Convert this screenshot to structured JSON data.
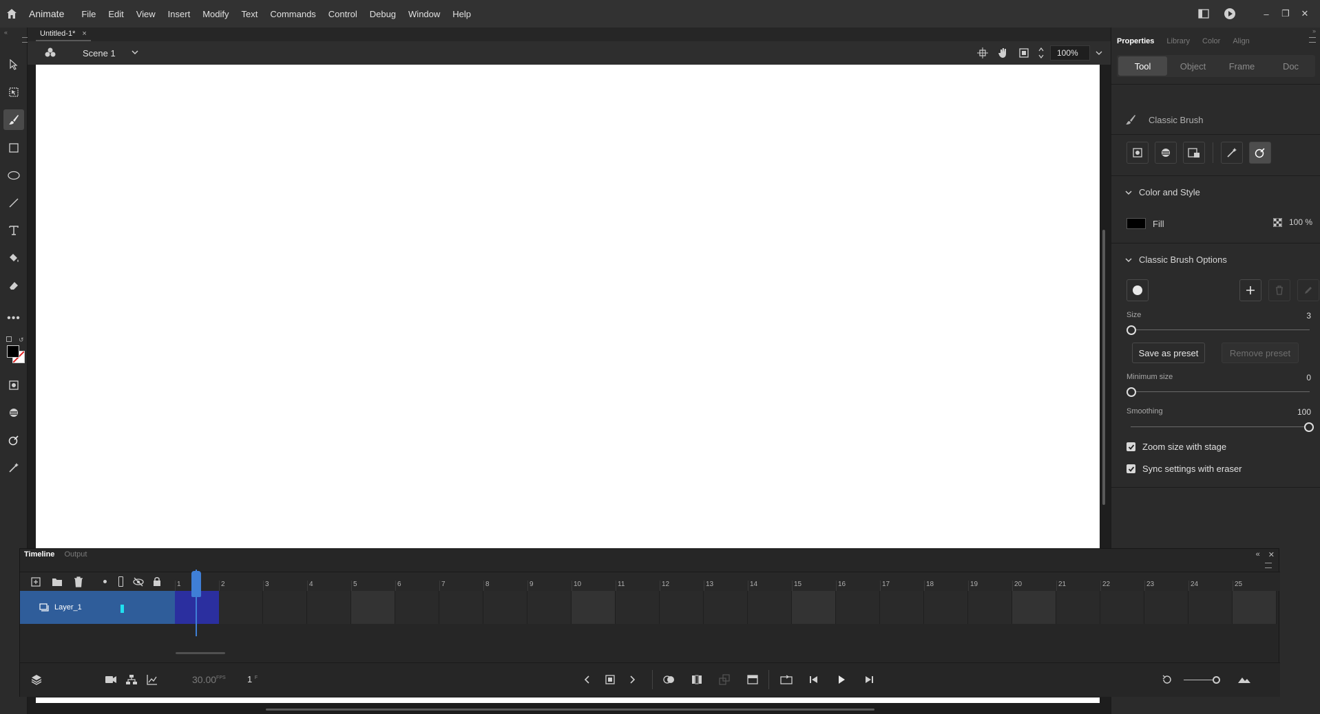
{
  "app": {
    "name": "Animate",
    "menus": [
      "File",
      "Edit",
      "View",
      "Insert",
      "Modify",
      "Text",
      "Commands",
      "Control",
      "Debug",
      "Window",
      "Help"
    ]
  },
  "document": {
    "tab_title": "Untitled-1*",
    "tab_close": "×",
    "scene_name": "Scene 1",
    "zoom": "100%"
  },
  "window_controls": {
    "minimize": "–",
    "restore": "❐",
    "close": "✕"
  },
  "properties_panel": {
    "tabs": [
      "Properties",
      "Library",
      "Color",
      "Align"
    ],
    "active_tab": "Properties",
    "subtabs": [
      "Tool",
      "Object",
      "Frame",
      "Doc"
    ],
    "active_subtab": "Tool",
    "tool_name": "Classic Brush",
    "color_and_style": {
      "heading": "Color and Style",
      "fill_label": "Fill",
      "fill_color": "#000000",
      "fill_alpha": "100 %"
    },
    "brush_options": {
      "heading": "Classic Brush Options",
      "size_label": "Size",
      "size_value": "3",
      "size_fraction": 0.0,
      "save_preset": "Save as preset",
      "remove_preset": "Remove preset",
      "min_size_label": "Minimum size",
      "min_size_value": "0",
      "min_size_fraction": 0.0,
      "smoothing_label": "Smoothing",
      "smoothing_value": "100",
      "smoothing_fraction": 1.0,
      "zoom_with_stage": "Zoom size with stage",
      "sync_with_eraser": "Sync settings with eraser"
    }
  },
  "timeline": {
    "tabs": [
      "Timeline",
      "Output"
    ],
    "active_tab": "Timeline",
    "frame_numbers": [
      "1",
      "2",
      "3",
      "4",
      "5",
      "6",
      "7",
      "8",
      "9",
      "10",
      "11",
      "12",
      "13",
      "14",
      "15",
      "16",
      "17",
      "18",
      "19",
      "20",
      "21",
      "22",
      "23",
      "24",
      "25"
    ],
    "layer_name": "Layer_1",
    "fps": "30.00",
    "fps_unit": "FPS",
    "current_frame": "1",
    "frame_unit": "F"
  },
  "colors": {
    "accent": "#3f7fd6",
    "layer_selected": "#2f5d9a",
    "keyframe_span": "#2b2f9f",
    "layer_indicator": "#20e0f0"
  }
}
